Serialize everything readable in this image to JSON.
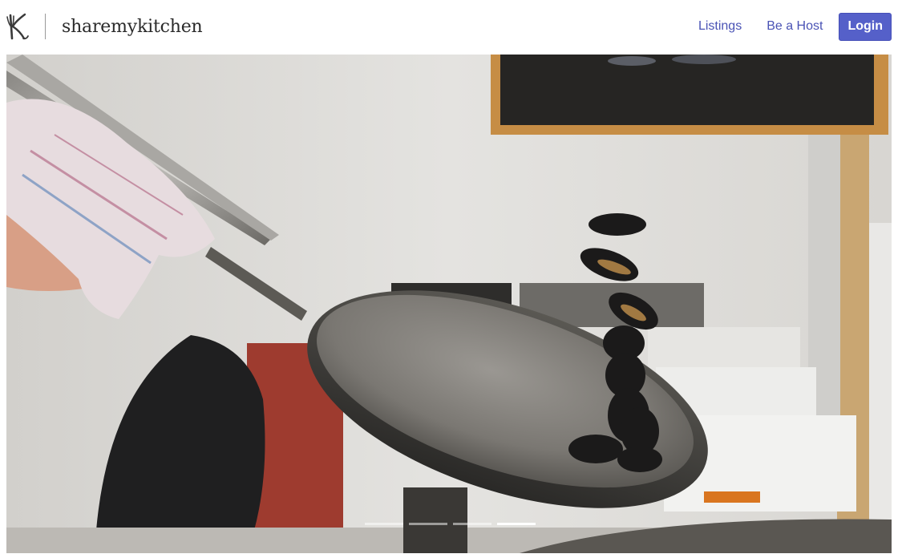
{
  "brand": {
    "name": "sharemykitchen",
    "logo_icon": "k-fork-knife-icon"
  },
  "nav": {
    "links": [
      {
        "label": "Listings"
      },
      {
        "label": "Be a Host"
      }
    ],
    "login_label": "Login"
  },
  "hero": {
    "image": "chef-tossing-mussels-in-wok",
    "slide_count": 4,
    "active_slide": 4
  },
  "colors": {
    "accent": "#5560c9",
    "link": "#4a53b5",
    "text": "#2a2a2a"
  }
}
